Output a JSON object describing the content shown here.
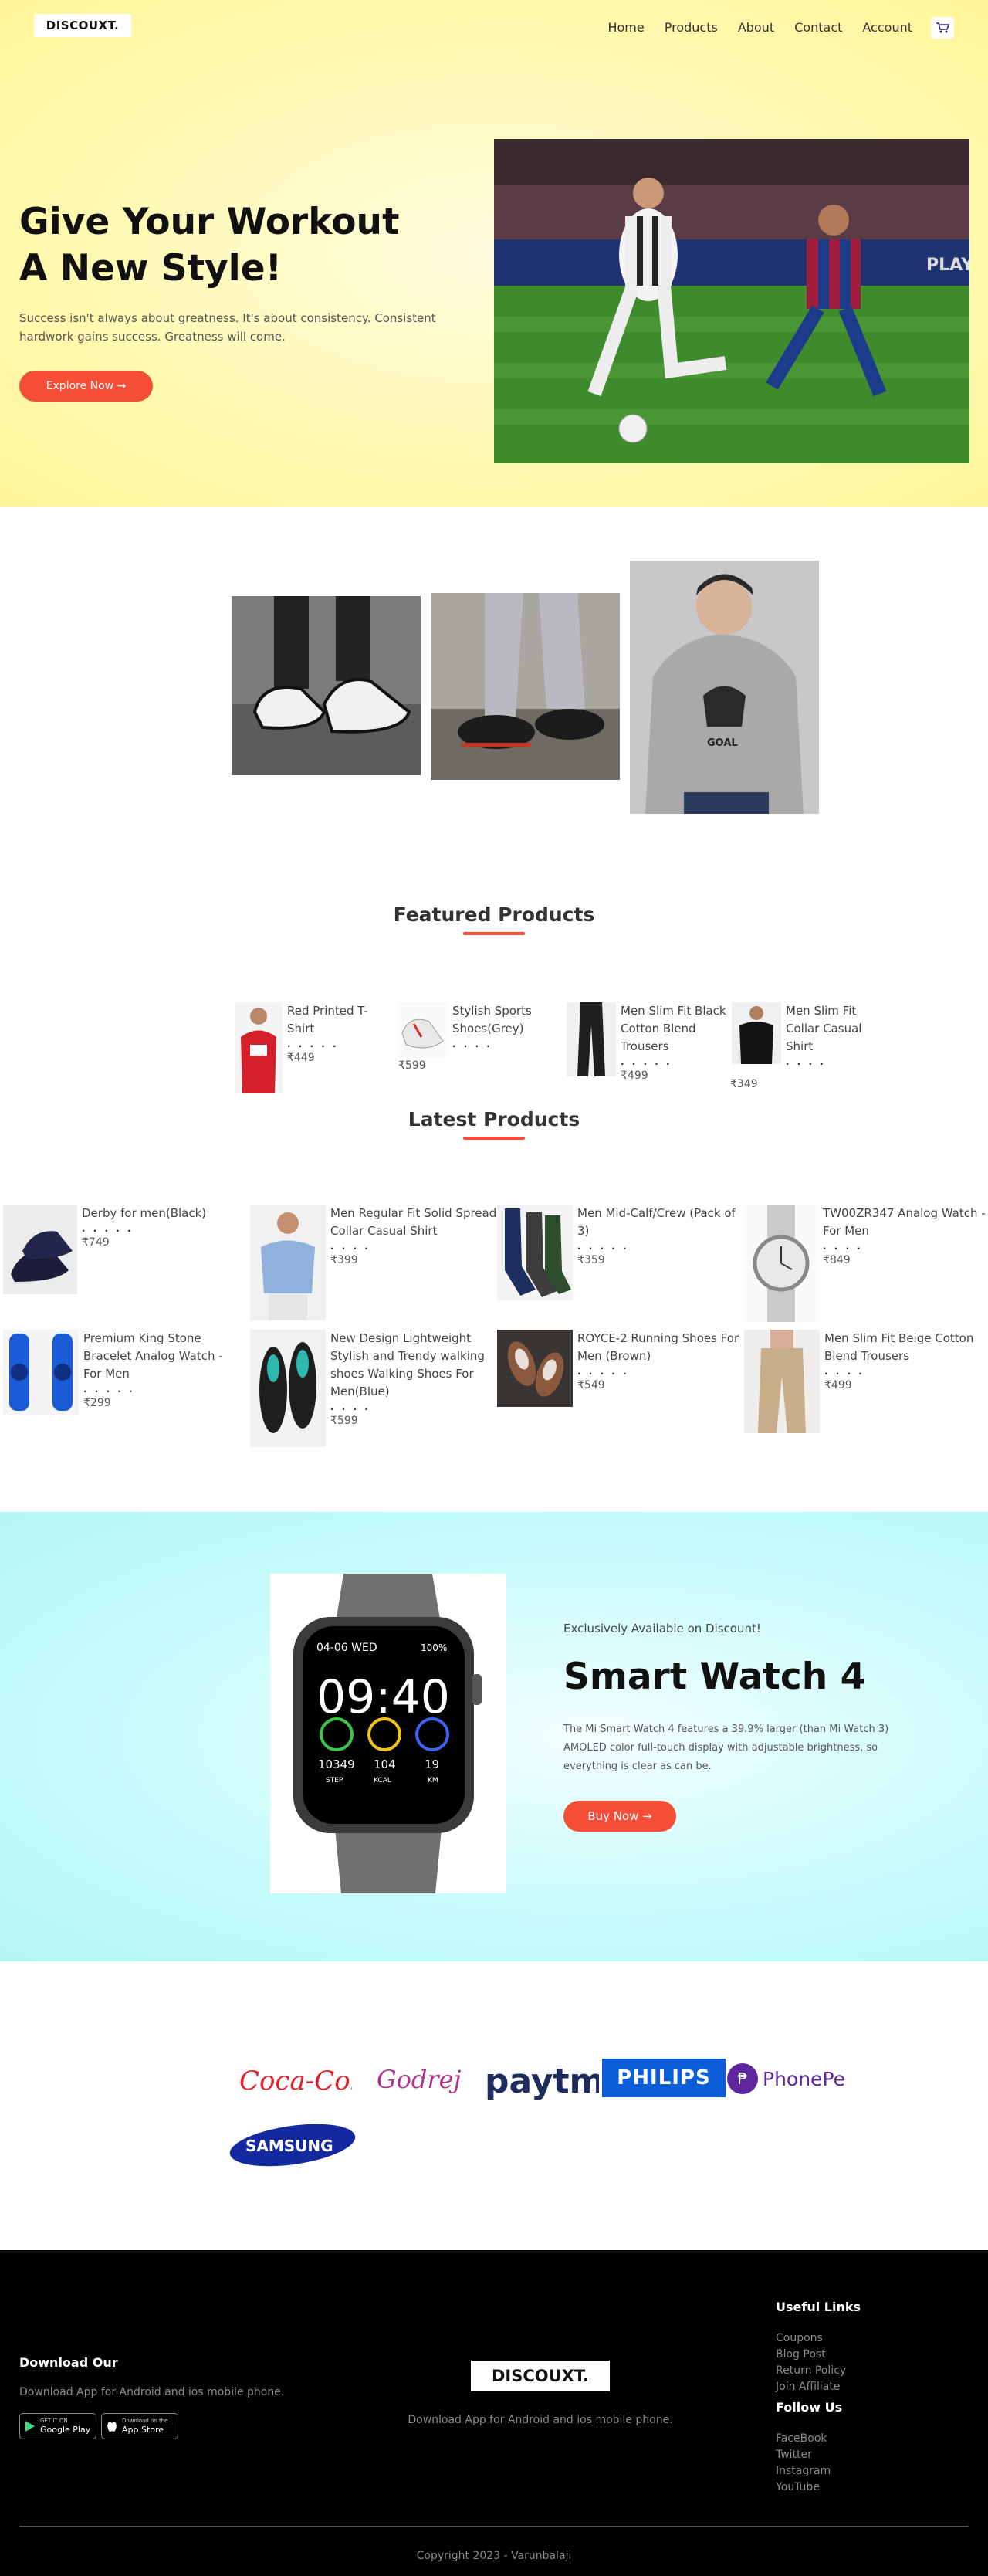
{
  "header": {
    "logo": "DISCOUXT.",
    "nav": [
      "Home",
      "Products",
      "About",
      "Contact",
      "Account"
    ],
    "cart_icon": "cart-icon"
  },
  "hero": {
    "title": "Give Your Workout\nA New Style!",
    "description": "Success isn't always about greatness. It's about consistency. Consistent hardwork gains success. Greatness will come.",
    "cta": "Explore Now →"
  },
  "featured": {
    "title": "Featured Products",
    "items": [
      {
        "name": "Red Printed T-Shirt",
        "stars": ". . . . .",
        "price": "₹449"
      },
      {
        "name": "Stylish Sports Shoes(Grey)",
        "stars": ". . . .",
        "price": "₹599"
      },
      {
        "name": "Men Slim Fit Black Cotton Blend Trousers",
        "stars": ". . . . .",
        "price": "₹499"
      },
      {
        "name": "Men Slim Fit Collar Casual Shirt",
        "stars": ". . . .",
        "price": "₹349"
      }
    ]
  },
  "latest": {
    "title": "Latest Products",
    "items": [
      {
        "name": "Derby for men(Black)",
        "stars": ". . . . .",
        "price": "₹749"
      },
      {
        "name": "Men Regular Fit Solid Spread Collar Casual Shirt",
        "stars": ". . . .",
        "price": "₹399"
      },
      {
        "name": "Men Mid-Calf/Crew (Pack of 3)",
        "stars": ". . . . .",
        "price": "₹359"
      },
      {
        "name": "TW00ZR347 Analog Watch - For Men",
        "stars": ". . . .",
        "price": "₹849"
      },
      {
        "name": "Premium King Stone Bracelet Analog Watch - For Men",
        "stars": ". . . . .",
        "price": "₹299"
      },
      {
        "name": "New Design Lightweight Stylish and Trendy walking shoes Walking Shoes For Men(Blue)",
        "stars": ". . . .",
        "price": "₹599"
      },
      {
        "name": "ROYCE-2 Running Shoes For Men (Brown)",
        "stars": ". . . . .",
        "price": "₹549"
      },
      {
        "name": "Men Slim Fit Beige Cotton Blend Trousers",
        "stars": ". . . .",
        "price": "₹499"
      }
    ]
  },
  "promo": {
    "eyebrow": "Exclusively Available on Discount!",
    "title": "Smart Watch 4",
    "description": "The Mi Smart Watch 4 features a 39.9% larger (than Mi Watch 3) AMOLED color full-touch display with adjustable brightness, so everything is clear as can be.",
    "cta": "Buy Now →",
    "watch_face": {
      "date": "04-06 WED",
      "battery": "100%",
      "time": "09:40",
      "steps": "10349",
      "steps_label": "STEP",
      "kcal": "104",
      "kcal_label": "KCAL",
      "km": "19",
      "km_label": "KM"
    }
  },
  "brands": [
    {
      "name": "Coca-Cola",
      "label": "Coca-Cola",
      "color": "#e41e2b"
    },
    {
      "name": "Godrej",
      "label": "Godrej",
      "color": "#b0338f"
    },
    {
      "name": "Paytm",
      "label": "paytm",
      "color": "#1d2b5e"
    },
    {
      "name": "Philips",
      "label": "PHILIPS",
      "color": "#0b5ed7"
    },
    {
      "name": "PhonePe",
      "label": "PhonePe",
      "color": "#5f259f"
    },
    {
      "name": "Samsung",
      "label": "SAMSUNG",
      "color": "#1428a0"
    }
  ],
  "footer": {
    "download_title": "Download Our",
    "download_text": "Download App for Android and ios mobile phone.",
    "google_small": "GET IT ON",
    "google_big": "Google Play",
    "apple_small": "Download on the",
    "apple_big": "App Store",
    "logo": "DISCOUXT.",
    "center_text": "Download App for Android and ios mobile phone.",
    "useful_title": "Useful Links",
    "useful_links": [
      "Coupons",
      "Blog Post",
      "Return Policy",
      "Join Affiliate"
    ],
    "follow_title": "Follow Us",
    "follow_links": [
      "FaceBook",
      "Twitter",
      "Instagram",
      "YouTube"
    ],
    "copyright": "Copyright 2023 - Varunbalaji"
  },
  "colors": {
    "accent": "#f44e37",
    "hero_bg": "#fff59a",
    "promo_bg": "#b3f6f6",
    "footer_bg": "#000000"
  }
}
